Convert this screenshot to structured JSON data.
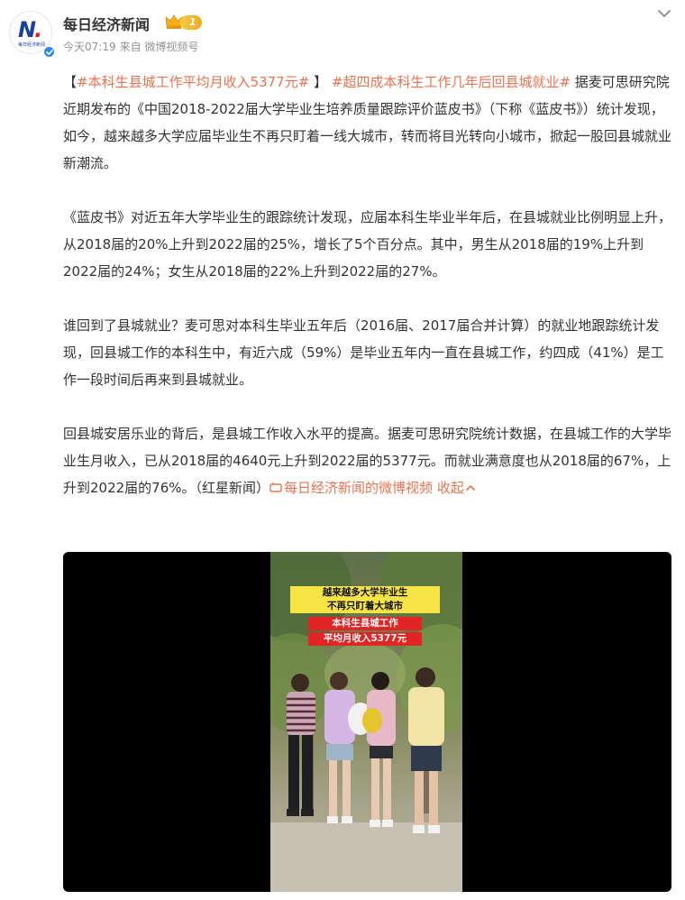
{
  "post": {
    "author": "每日经济新闻",
    "level": "1",
    "time": "今天07:19",
    "source": "来自 微博视频号",
    "avatar_text": "每日经济新闻",
    "avatar_sub": "NATIONAL BUSINESS DAILY"
  },
  "article": {
    "open_bracket": "【",
    "tag1": "#本科生县城工作平均月收入5377元#",
    "close_bracket": " 】",
    "tag2": "#超四成本科生工作几年后回县城就业#",
    "p1_rest": " 据麦可思研究院近期发布的《中国2018-2022届大学毕业生培养质量跟踪评价蓝皮书》（下称《蓝皮书》）统计发现，如今，越来越多大学应届毕业生不再只盯着一线大城市，转而将目光转向小城市，掀起一股回县城就业新潮流。",
    "p2": "《蓝皮书》对近五年大学毕业生的跟踪统计发现，应届本科生毕业半年后，在县城就业比例明显上升，从2018届的20%上升到2022届的25%，增长了5个百分点。其中，男生从2018届的19%上升到2022届的24%；女生从2018届的22%上升到2022届的27%。",
    "p3": "谁回到了县城就业？麦可思对本科生毕业五年后（2016届、2017届合并计算）的就业地跟踪统计发现，回县城工作的本科生中，有近六成（59%）是毕业五年内一直在县城工作，约四成（41%）是工作一段时间后再来到县城就业。",
    "p4": "回县城安居乐业的背后，是县城工作收入水平的提高。据麦可思研究院统计数据，在县城工作的大学毕业生月收入，已从2018届的4640元上升到2022届的5377元。而就业满意度也从2018届的67%，上升到2022届的76%。（红星新闻）",
    "video_link": "每日经济新闻的微博视频",
    "collapse": "收起"
  },
  "video": {
    "caption1": "越来越多大学毕业生",
    "caption2": "不再只盯着大城市",
    "caption3": "本科生县城工作",
    "caption4": "平均月收入5377元"
  },
  "colors": {
    "accent": "#eb7350",
    "text": "#333333",
    "meta": "#939393",
    "verified": "#2a8ee8"
  },
  "icons": [
    "chevron-down-icon",
    "crown-icon",
    "verified-icon",
    "video-icon",
    "chevron-up-icon"
  ]
}
